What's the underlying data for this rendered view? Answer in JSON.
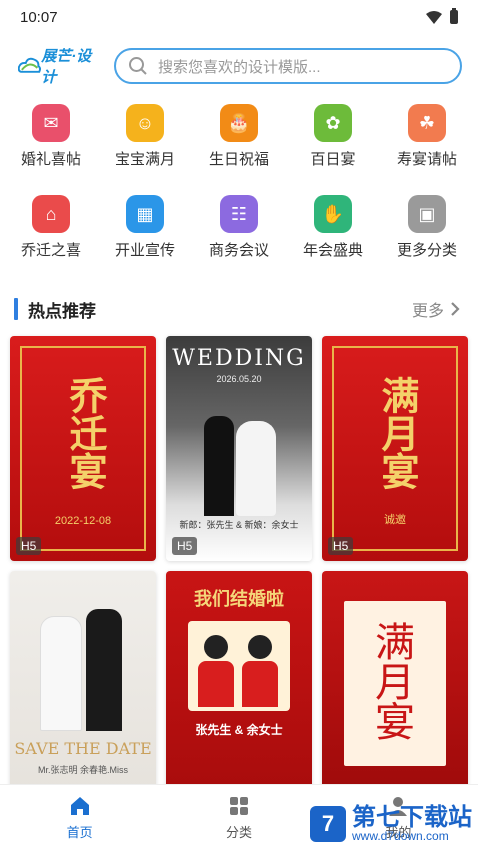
{
  "status": {
    "time": "10:07"
  },
  "header": {
    "logo_text": "展芒·设计",
    "search_placeholder": "搜索您喜欢的设计模版..."
  },
  "categories": [
    {
      "label": "婚礼喜帖",
      "color": "#e9506b",
      "icon": "envelope-heart-icon",
      "glyph": "✉"
    },
    {
      "label": "宝宝满月",
      "color": "#f5b21c",
      "icon": "baby-icon",
      "glyph": "☺"
    },
    {
      "label": "生日祝福",
      "color": "#f28b16",
      "icon": "cake-icon",
      "glyph": "🎂"
    },
    {
      "label": "百日宴",
      "color": "#6dbb3a",
      "icon": "baby-hundred-days-icon",
      "glyph": "✿"
    },
    {
      "label": "寿宴请帖",
      "color": "#f27b4f",
      "icon": "elder-icon",
      "glyph": "☘"
    },
    {
      "label": "乔迁之喜",
      "color": "#ea4b4b",
      "icon": "house-icon",
      "glyph": "⌂"
    },
    {
      "label": "开业宣传",
      "color": "#2b96e8",
      "icon": "store-icon",
      "glyph": "▦"
    },
    {
      "label": "商务会议",
      "color": "#8c6ae0",
      "icon": "meeting-icon",
      "glyph": "☷"
    },
    {
      "label": "年会盛典",
      "color": "#2fb57a",
      "icon": "handshake-icon",
      "glyph": "✋"
    },
    {
      "label": "更多分类",
      "color": "#9a9a9a",
      "icon": "grid-more-icon",
      "glyph": "▣"
    }
  ],
  "section": {
    "title": "热点推荐",
    "more": "更多"
  },
  "cards": [
    {
      "tag": "H5",
      "title": "乔迁宴",
      "sub": "2022-12-08",
      "style": "red"
    },
    {
      "tag": "H5",
      "title": "WEDDING",
      "sub": "2026.05.20",
      "caption": "新郎：张先生 & 新娘：余女士",
      "style": "photo"
    },
    {
      "tag": "H5",
      "title": "满月宴",
      "sub": "诚邀",
      "style": "red"
    },
    {
      "tag": "",
      "title": "SAVE THE DATE",
      "sub": "Mr.张志明  余春艳.Miss",
      "style": "photo2"
    },
    {
      "tag": "",
      "title": "我们结婚啦",
      "sub": "张先生 & 余女士",
      "style": "red2"
    },
    {
      "tag": "",
      "title": "满月宴",
      "sub": "",
      "style": "red3"
    }
  ],
  "bottom_nav": [
    {
      "label": "首页",
      "icon": "home-icon",
      "active": true
    },
    {
      "label": "分类",
      "icon": "category-icon",
      "active": false
    },
    {
      "label": "我的",
      "icon": "profile-icon",
      "active": false
    }
  ],
  "watermark": {
    "cn": "第七下载站",
    "url": "www.d7down.com"
  },
  "colors": {
    "accent": "#2f7fe0",
    "search_border": "#4aa3e6"
  }
}
